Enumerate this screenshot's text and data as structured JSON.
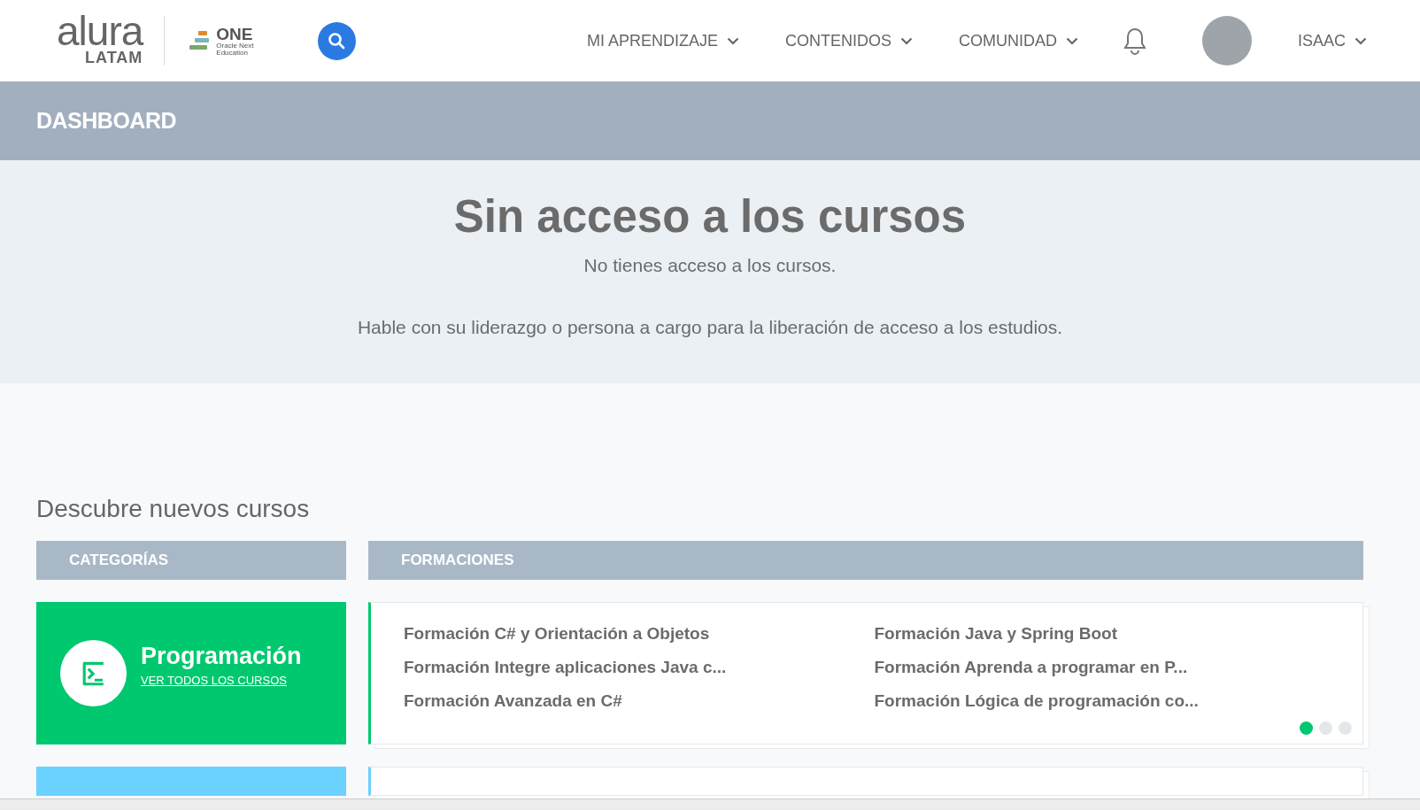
{
  "header": {
    "logo": {
      "word": "alura",
      "region": "LATAM"
    },
    "partner_logo": {
      "word": "ONE",
      "line_1": "Oracle Next",
      "line_2": "Education"
    },
    "nav": [
      {
        "label": "MI APRENDIZAJE"
      },
      {
        "label": "CONTENIDOS"
      },
      {
        "label": "COMUNIDAD"
      }
    ],
    "user": {
      "name": "ISAAC"
    }
  },
  "page_title": "DASHBOARD",
  "notice": {
    "title": "Sin acceso a los cursos",
    "subtitle": "No tienes acceso a los cursos.",
    "message": "Hable con su liderazgo o persona a cargo para la liberación de acceso a los estudios."
  },
  "discover": {
    "title": "Descubre nuevos cursos",
    "columns": [
      "CATEGORÍAS",
      "FORMACIONES"
    ],
    "categories": [
      {
        "title": "Programación",
        "link": "VER TODOS LOS CURSOS",
        "color": "#00c86f",
        "formations": [
          "Formación C# y Orientación a Objetos",
          "Formación Java y Spring Boot",
          "Formación Integre aplicaciones Java c...",
          "Formación Aprenda a programar en P...",
          "Formación Avanzada en C#",
          "Formación Lógica de programación co..."
        ],
        "pages": [
          {
            "selected": true
          },
          {
            "selected": false
          },
          {
            "selected": false
          }
        ]
      },
      {
        "color": "#6bd1ff"
      }
    ]
  }
}
